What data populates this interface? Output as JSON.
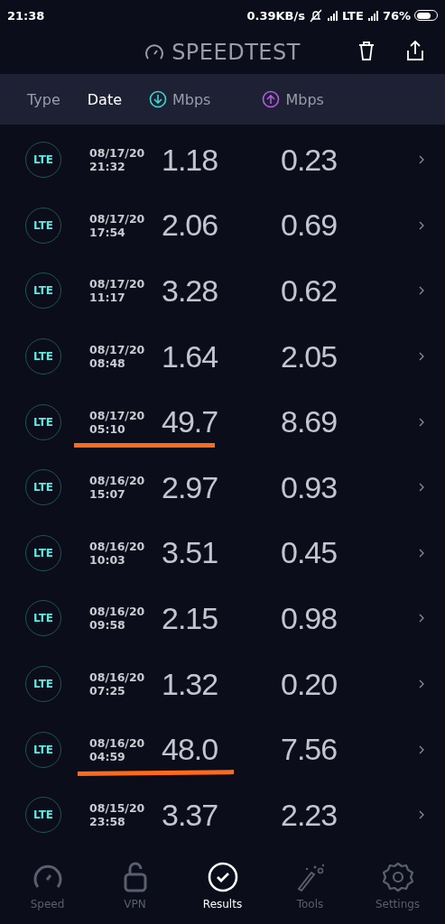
{
  "status_bar": {
    "time": "21:38",
    "speed": "0.39KB/s",
    "network": "LTE",
    "battery": "76%"
  },
  "header": {
    "title": "SPEEDTEST"
  },
  "columns": [
    {
      "label": "Type",
      "selected": false,
      "kind": "text"
    },
    {
      "label": "Date",
      "selected": true,
      "kind": "text"
    },
    {
      "label": "Mbps",
      "selected": false,
      "kind": "download"
    },
    {
      "label": "Mbps",
      "selected": false,
      "kind": "upload"
    }
  ],
  "results": [
    {
      "type": "LTE",
      "date": "08/17/20",
      "time": "21:32",
      "download": "1.18",
      "upload": "0.23",
      "underlined": false
    },
    {
      "type": "LTE",
      "date": "08/17/20",
      "time": "17:54",
      "download": "2.06",
      "upload": "0.69",
      "underlined": false
    },
    {
      "type": "LTE",
      "date": "08/17/20",
      "time": "11:17",
      "download": "3.28",
      "upload": "0.62",
      "underlined": false
    },
    {
      "type": "LTE",
      "date": "08/17/20",
      "time": "08:48",
      "download": "1.64",
      "upload": "2.05",
      "underlined": false
    },
    {
      "type": "LTE",
      "date": "08/17/20",
      "time": "05:10",
      "download": "49.7",
      "upload": "8.69",
      "underlined": true
    },
    {
      "type": "LTE",
      "date": "08/16/20",
      "time": "15:07",
      "download": "2.97",
      "upload": "0.93",
      "underlined": false
    },
    {
      "type": "LTE",
      "date": "08/16/20",
      "time": "10:03",
      "download": "3.51",
      "upload": "0.45",
      "underlined": false
    },
    {
      "type": "LTE",
      "date": "08/16/20",
      "time": "09:58",
      "download": "2.15",
      "upload": "0.98",
      "underlined": false
    },
    {
      "type": "LTE",
      "date": "08/16/20",
      "time": "07:25",
      "download": "1.32",
      "upload": "0.20",
      "underlined": false
    },
    {
      "type": "LTE",
      "date": "08/16/20",
      "time": "04:59",
      "download": "48.0",
      "upload": "7.56",
      "underlined": true
    },
    {
      "type": "LTE",
      "date": "08/15/20",
      "time": "23:58",
      "download": "3.37",
      "upload": "2.23",
      "underlined": false
    }
  ],
  "nav": [
    {
      "label": "Speed",
      "kind": "speed",
      "selected": false
    },
    {
      "label": "VPN",
      "kind": "vpn",
      "selected": false
    },
    {
      "label": "Results",
      "kind": "results",
      "selected": true
    },
    {
      "label": "Tools",
      "kind": "tools",
      "selected": false
    },
    {
      "label": "Settings",
      "kind": "settings",
      "selected": false
    }
  ]
}
